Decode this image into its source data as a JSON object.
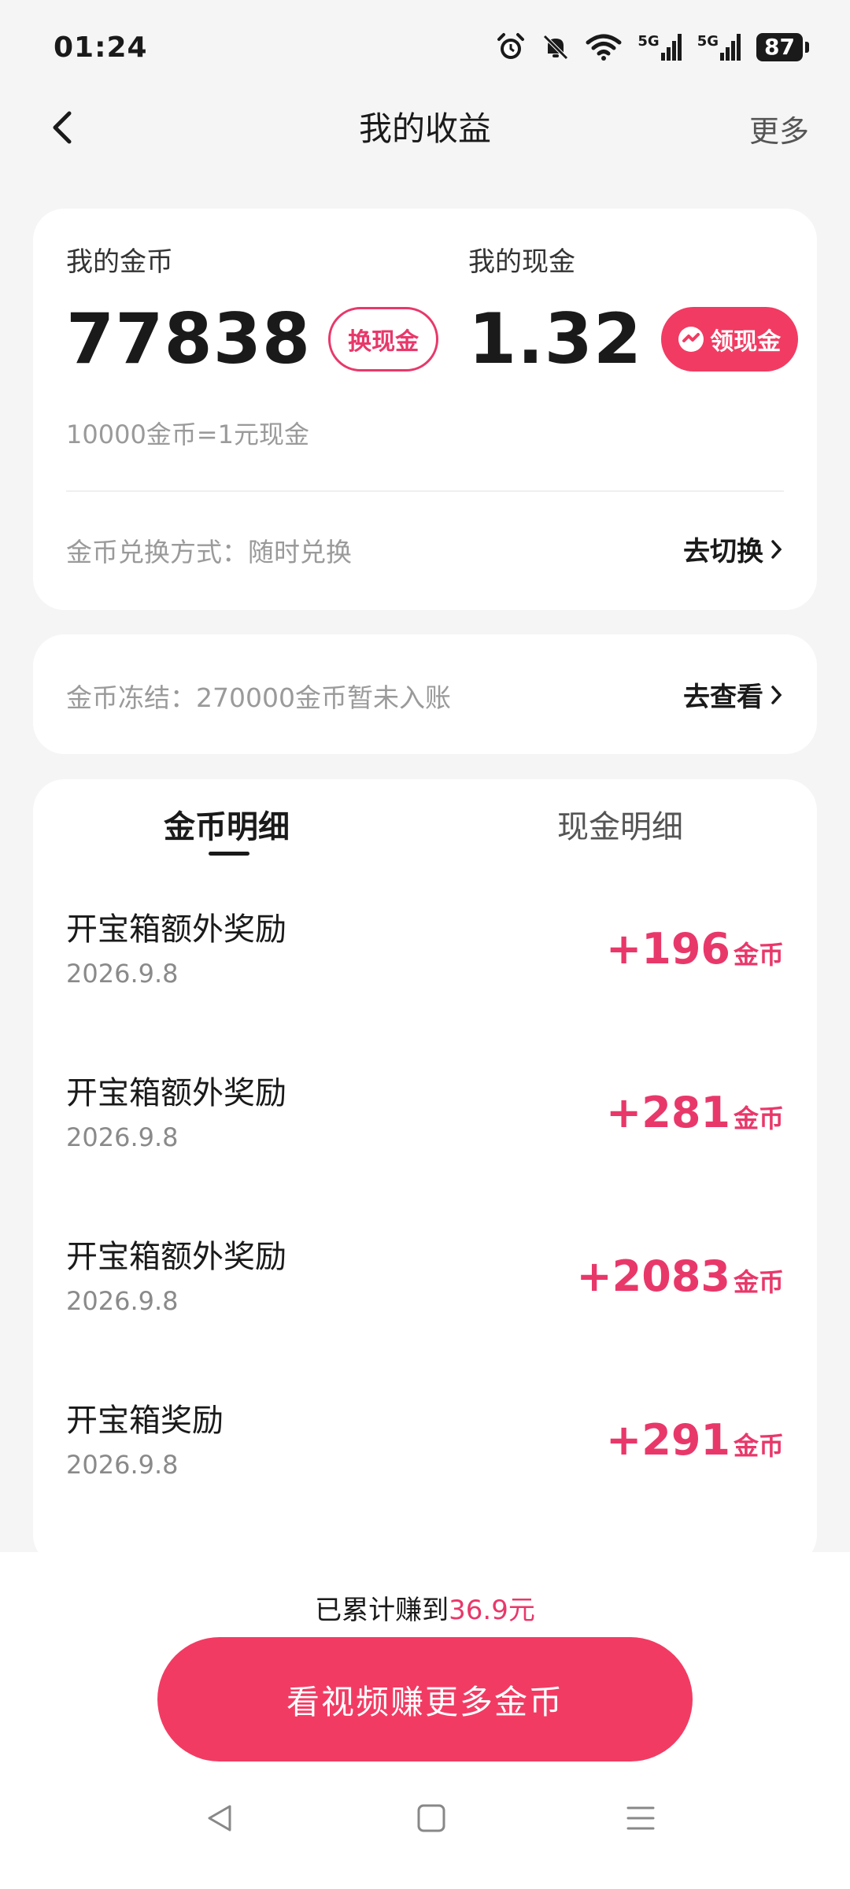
{
  "status_bar": {
    "time": "01:24",
    "signal1": "5G",
    "signal2": "5G",
    "battery": "87"
  },
  "nav": {
    "title": "我的收益",
    "more": "更多"
  },
  "wallet": {
    "coins_label": "我的金币",
    "coins_value": "77838",
    "exchange_button": "换现金",
    "cash_label": "我的现金",
    "cash_value": "1.32",
    "claim_button": "领现金",
    "rate_text": "10000金币=1元现金",
    "exchange_method_text": "金币兑换方式：随时兑换",
    "switch_action": "去切换"
  },
  "frozen": {
    "text": "金币冻结：270000金币暂未入账",
    "action": "去查看"
  },
  "tabs": [
    {
      "label": "金币明细",
      "active": true
    },
    {
      "label": "现金明细",
      "active": false
    }
  ],
  "records": [
    {
      "title": "开宝箱额外奖励",
      "date": "2026.9.8",
      "amount": "+196",
      "unit": "金币"
    },
    {
      "title": "开宝箱额外奖励",
      "date": "2026.9.8",
      "amount": "+281",
      "unit": "金币"
    },
    {
      "title": "开宝箱额外奖励",
      "date": "2026.9.8",
      "amount": "+2083",
      "unit": "金币"
    },
    {
      "title": "开宝箱奖励",
      "date": "2026.9.8",
      "amount": "+291",
      "unit": "金币"
    }
  ],
  "footer": {
    "total_prefix": "已累计赚到",
    "total_value": "36.9元",
    "cta": "看视频赚更多金币"
  },
  "colors": {
    "accent": "#f23b63",
    "accent_text": "#e8386a",
    "background": "#f5f5f5"
  }
}
